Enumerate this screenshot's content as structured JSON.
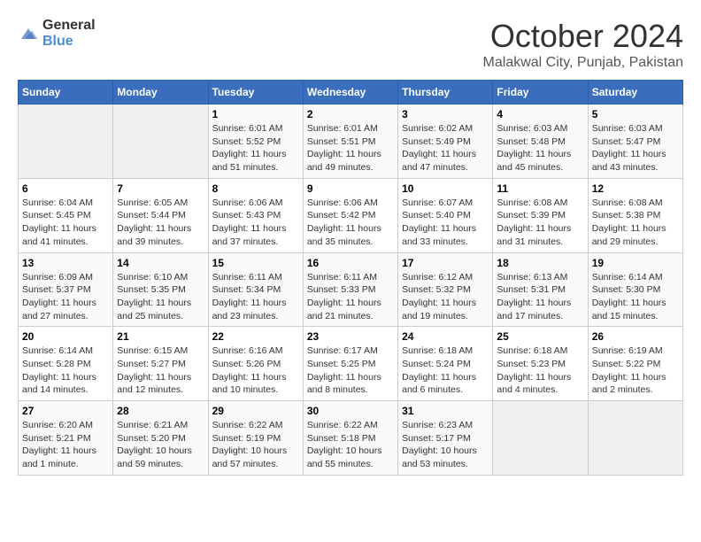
{
  "logo": {
    "text_general": "General",
    "text_blue": "Blue"
  },
  "title": {
    "month": "October 2024",
    "location": "Malakwal City, Punjab, Pakistan"
  },
  "weekdays": [
    "Sunday",
    "Monday",
    "Tuesday",
    "Wednesday",
    "Thursday",
    "Friday",
    "Saturday"
  ],
  "weeks": [
    [
      {
        "day": "",
        "sunrise": "",
        "sunset": "",
        "daylight": ""
      },
      {
        "day": "",
        "sunrise": "",
        "sunset": "",
        "daylight": ""
      },
      {
        "day": "1",
        "sunrise": "Sunrise: 6:01 AM",
        "sunset": "Sunset: 5:52 PM",
        "daylight": "Daylight: 11 hours and 51 minutes."
      },
      {
        "day": "2",
        "sunrise": "Sunrise: 6:01 AM",
        "sunset": "Sunset: 5:51 PM",
        "daylight": "Daylight: 11 hours and 49 minutes."
      },
      {
        "day": "3",
        "sunrise": "Sunrise: 6:02 AM",
        "sunset": "Sunset: 5:49 PM",
        "daylight": "Daylight: 11 hours and 47 minutes."
      },
      {
        "day": "4",
        "sunrise": "Sunrise: 6:03 AM",
        "sunset": "Sunset: 5:48 PM",
        "daylight": "Daylight: 11 hours and 45 minutes."
      },
      {
        "day": "5",
        "sunrise": "Sunrise: 6:03 AM",
        "sunset": "Sunset: 5:47 PM",
        "daylight": "Daylight: 11 hours and 43 minutes."
      }
    ],
    [
      {
        "day": "6",
        "sunrise": "Sunrise: 6:04 AM",
        "sunset": "Sunset: 5:45 PM",
        "daylight": "Daylight: 11 hours and 41 minutes."
      },
      {
        "day": "7",
        "sunrise": "Sunrise: 6:05 AM",
        "sunset": "Sunset: 5:44 PM",
        "daylight": "Daylight: 11 hours and 39 minutes."
      },
      {
        "day": "8",
        "sunrise": "Sunrise: 6:06 AM",
        "sunset": "Sunset: 5:43 PM",
        "daylight": "Daylight: 11 hours and 37 minutes."
      },
      {
        "day": "9",
        "sunrise": "Sunrise: 6:06 AM",
        "sunset": "Sunset: 5:42 PM",
        "daylight": "Daylight: 11 hours and 35 minutes."
      },
      {
        "day": "10",
        "sunrise": "Sunrise: 6:07 AM",
        "sunset": "Sunset: 5:40 PM",
        "daylight": "Daylight: 11 hours and 33 minutes."
      },
      {
        "day": "11",
        "sunrise": "Sunrise: 6:08 AM",
        "sunset": "Sunset: 5:39 PM",
        "daylight": "Daylight: 11 hours and 31 minutes."
      },
      {
        "day": "12",
        "sunrise": "Sunrise: 6:08 AM",
        "sunset": "Sunset: 5:38 PM",
        "daylight": "Daylight: 11 hours and 29 minutes."
      }
    ],
    [
      {
        "day": "13",
        "sunrise": "Sunrise: 6:09 AM",
        "sunset": "Sunset: 5:37 PM",
        "daylight": "Daylight: 11 hours and 27 minutes."
      },
      {
        "day": "14",
        "sunrise": "Sunrise: 6:10 AM",
        "sunset": "Sunset: 5:35 PM",
        "daylight": "Daylight: 11 hours and 25 minutes."
      },
      {
        "day": "15",
        "sunrise": "Sunrise: 6:11 AM",
        "sunset": "Sunset: 5:34 PM",
        "daylight": "Daylight: 11 hours and 23 minutes."
      },
      {
        "day": "16",
        "sunrise": "Sunrise: 6:11 AM",
        "sunset": "Sunset: 5:33 PM",
        "daylight": "Daylight: 11 hours and 21 minutes."
      },
      {
        "day": "17",
        "sunrise": "Sunrise: 6:12 AM",
        "sunset": "Sunset: 5:32 PM",
        "daylight": "Daylight: 11 hours and 19 minutes."
      },
      {
        "day": "18",
        "sunrise": "Sunrise: 6:13 AM",
        "sunset": "Sunset: 5:31 PM",
        "daylight": "Daylight: 11 hours and 17 minutes."
      },
      {
        "day": "19",
        "sunrise": "Sunrise: 6:14 AM",
        "sunset": "Sunset: 5:30 PM",
        "daylight": "Daylight: 11 hours and 15 minutes."
      }
    ],
    [
      {
        "day": "20",
        "sunrise": "Sunrise: 6:14 AM",
        "sunset": "Sunset: 5:28 PM",
        "daylight": "Daylight: 11 hours and 14 minutes."
      },
      {
        "day": "21",
        "sunrise": "Sunrise: 6:15 AM",
        "sunset": "Sunset: 5:27 PM",
        "daylight": "Daylight: 11 hours and 12 minutes."
      },
      {
        "day": "22",
        "sunrise": "Sunrise: 6:16 AM",
        "sunset": "Sunset: 5:26 PM",
        "daylight": "Daylight: 11 hours and 10 minutes."
      },
      {
        "day": "23",
        "sunrise": "Sunrise: 6:17 AM",
        "sunset": "Sunset: 5:25 PM",
        "daylight": "Daylight: 11 hours and 8 minutes."
      },
      {
        "day": "24",
        "sunrise": "Sunrise: 6:18 AM",
        "sunset": "Sunset: 5:24 PM",
        "daylight": "Daylight: 11 hours and 6 minutes."
      },
      {
        "day": "25",
        "sunrise": "Sunrise: 6:18 AM",
        "sunset": "Sunset: 5:23 PM",
        "daylight": "Daylight: 11 hours and 4 minutes."
      },
      {
        "day": "26",
        "sunrise": "Sunrise: 6:19 AM",
        "sunset": "Sunset: 5:22 PM",
        "daylight": "Daylight: 11 hours and 2 minutes."
      }
    ],
    [
      {
        "day": "27",
        "sunrise": "Sunrise: 6:20 AM",
        "sunset": "Sunset: 5:21 PM",
        "daylight": "Daylight: 11 hours and 1 minute."
      },
      {
        "day": "28",
        "sunrise": "Sunrise: 6:21 AM",
        "sunset": "Sunset: 5:20 PM",
        "daylight": "Daylight: 10 hours and 59 minutes."
      },
      {
        "day": "29",
        "sunrise": "Sunrise: 6:22 AM",
        "sunset": "Sunset: 5:19 PM",
        "daylight": "Daylight: 10 hours and 57 minutes."
      },
      {
        "day": "30",
        "sunrise": "Sunrise: 6:22 AM",
        "sunset": "Sunset: 5:18 PM",
        "daylight": "Daylight: 10 hours and 55 minutes."
      },
      {
        "day": "31",
        "sunrise": "Sunrise: 6:23 AM",
        "sunset": "Sunset: 5:17 PM",
        "daylight": "Daylight: 10 hours and 53 minutes."
      },
      {
        "day": "",
        "sunrise": "",
        "sunset": "",
        "daylight": ""
      },
      {
        "day": "",
        "sunrise": "",
        "sunset": "",
        "daylight": ""
      }
    ]
  ]
}
